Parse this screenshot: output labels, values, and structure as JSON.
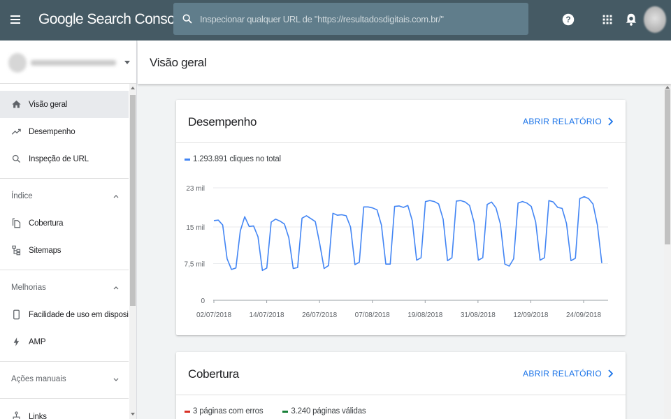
{
  "app": {
    "title": "Google Search Console",
    "search_placeholder": "Inspecionar qualquer URL de \"https://resultadosdigitais.com.br/\"",
    "topbar_icons": [
      "menu-icon",
      "search-icon",
      "help-icon",
      "apps-grid-icon",
      "notifications-icon"
    ]
  },
  "sidebar": {
    "items_top": [
      {
        "label": "Visão geral",
        "icon": "home-icon",
        "active": true
      },
      {
        "label": "Desempenho",
        "icon": "trending-up-icon"
      },
      {
        "label": "Inspeção de URL",
        "icon": "search-icon"
      }
    ],
    "sections": [
      {
        "title": "Índice",
        "expanded": true,
        "items": [
          {
            "label": "Cobertura",
            "icon": "file-copy-icon"
          },
          {
            "label": "Sitemaps",
            "icon": "sitemap-icon"
          }
        ]
      },
      {
        "title": "Melhorias",
        "expanded": true,
        "items": [
          {
            "label": "Facilidade de uso em disposi…",
            "icon": "smartphone-icon"
          },
          {
            "label": "AMP",
            "icon": "bolt-icon"
          }
        ]
      },
      {
        "title": "Ações manuais",
        "expanded": false,
        "items": []
      }
    ],
    "items_bottom": [
      {
        "label": "Links",
        "icon": "links-icon"
      }
    ]
  },
  "main": {
    "page_title": "Visão geral",
    "performance": {
      "title": "Desempenho",
      "link": "ABRIR RELATÓRIO",
      "legend": "1.293.891 cliques no total",
      "color": "#4285f4"
    },
    "coverage": {
      "title": "Cobertura",
      "link": "ABRIR RELATÓRIO",
      "legend_errors": "3 páginas com erros",
      "legend_valid": "3.240 páginas válidas",
      "color_errors": "#d93025",
      "color_valid": "#188038"
    }
  },
  "chart_data": {
    "type": "line",
    "title": "",
    "xlabel": "",
    "ylabel": "",
    "y_ticks": [
      0,
      7.5,
      15,
      23
    ],
    "y_tick_labels": [
      "0",
      "7,5 mil",
      "15 mil",
      "23 mil"
    ],
    "ylim": [
      0,
      23
    ],
    "x_tick_labels": [
      "02/07/2018",
      "14/07/2018",
      "26/07/2018",
      "07/08/2018",
      "19/08/2018",
      "31/08/2018",
      "12/09/2018",
      "24/09/2018"
    ],
    "grid": true,
    "series": [
      {
        "name": "cliques",
        "color": "#4285f4",
        "values": [
          16.3,
          16.4,
          15.4,
          8.5,
          6.3,
          6.6,
          14.2,
          17.1,
          15.1,
          15.2,
          13.0,
          6.1,
          6.6,
          16.0,
          16.6,
          16.2,
          15.6,
          12.8,
          6.5,
          6.7,
          16.8,
          17.3,
          16.7,
          16.1,
          11.6,
          6.5,
          7.1,
          17.8,
          17.4,
          17.5,
          17.3,
          15.0,
          7.3,
          7.8,
          19.1,
          19.1,
          18.9,
          18.5,
          15.4,
          7.4,
          7.4,
          19.2,
          19.3,
          19.0,
          19.4,
          16.3,
          8.2,
          8.7,
          20.2,
          20.4,
          20.2,
          19.7,
          16.6,
          8.1,
          8.7,
          20.3,
          20.4,
          20.1,
          19.4,
          16.0,
          8.2,
          8.7,
          19.6,
          20.1,
          18.9,
          15.6,
          7.4,
          7.0,
          8.5,
          19.9,
          20.2,
          19.9,
          19.2,
          16.0,
          8.2,
          8.7,
          20.4,
          20.1,
          19.0,
          18.8,
          15.7,
          8.1,
          8.6,
          20.8,
          21.2,
          20.8,
          19.7,
          15.4,
          7.6
        ]
      }
    ]
  }
}
